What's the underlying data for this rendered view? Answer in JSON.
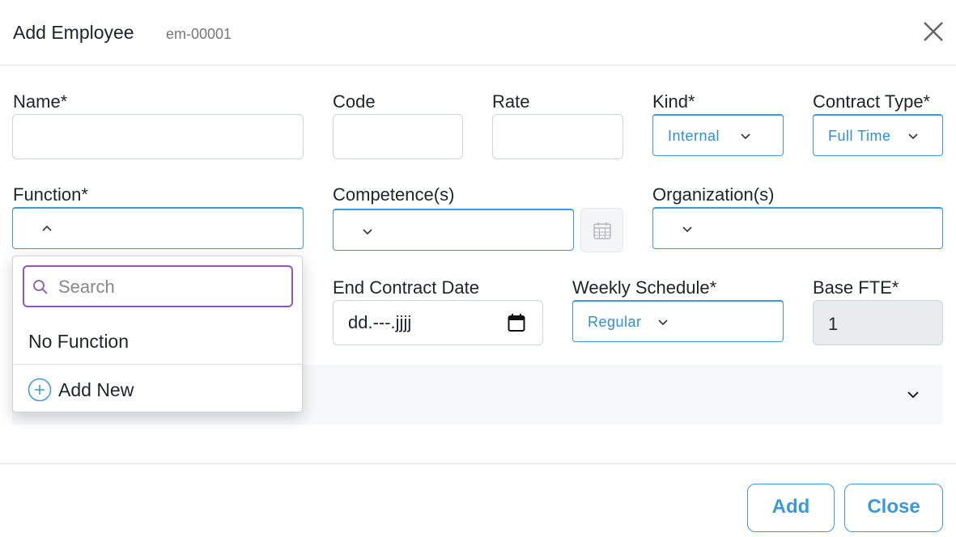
{
  "header": {
    "title": "Add Employee",
    "employee_code": "em-00001"
  },
  "form": {
    "name_label": "Name*",
    "code_label": "Code",
    "rate_label": "Rate",
    "kind_label": "Kind*",
    "kind_value": "Internal",
    "contract_type_label": "Contract Type*",
    "contract_type_value": "Full Time",
    "function_label": "Function*",
    "competence_label": "Competence(s)",
    "organization_label": "Organization(s)",
    "end_contract_label": "End Contract Date",
    "end_contract_placeholder": "dd.---.jjjj",
    "weekly_schedule_label": "Weekly Schedule*",
    "weekly_schedule_value": "Regular",
    "base_fte_label": "Base FTE*",
    "base_fte_value": "1"
  },
  "function_dropdown": {
    "search_placeholder": "Search",
    "options": [
      "No Function"
    ],
    "add_new_label": "Add New"
  },
  "footer": {
    "add_label": "Add",
    "close_label": "Close"
  },
  "colors": {
    "accent": "#3b99d9",
    "search_focus": "#8e58b7"
  }
}
